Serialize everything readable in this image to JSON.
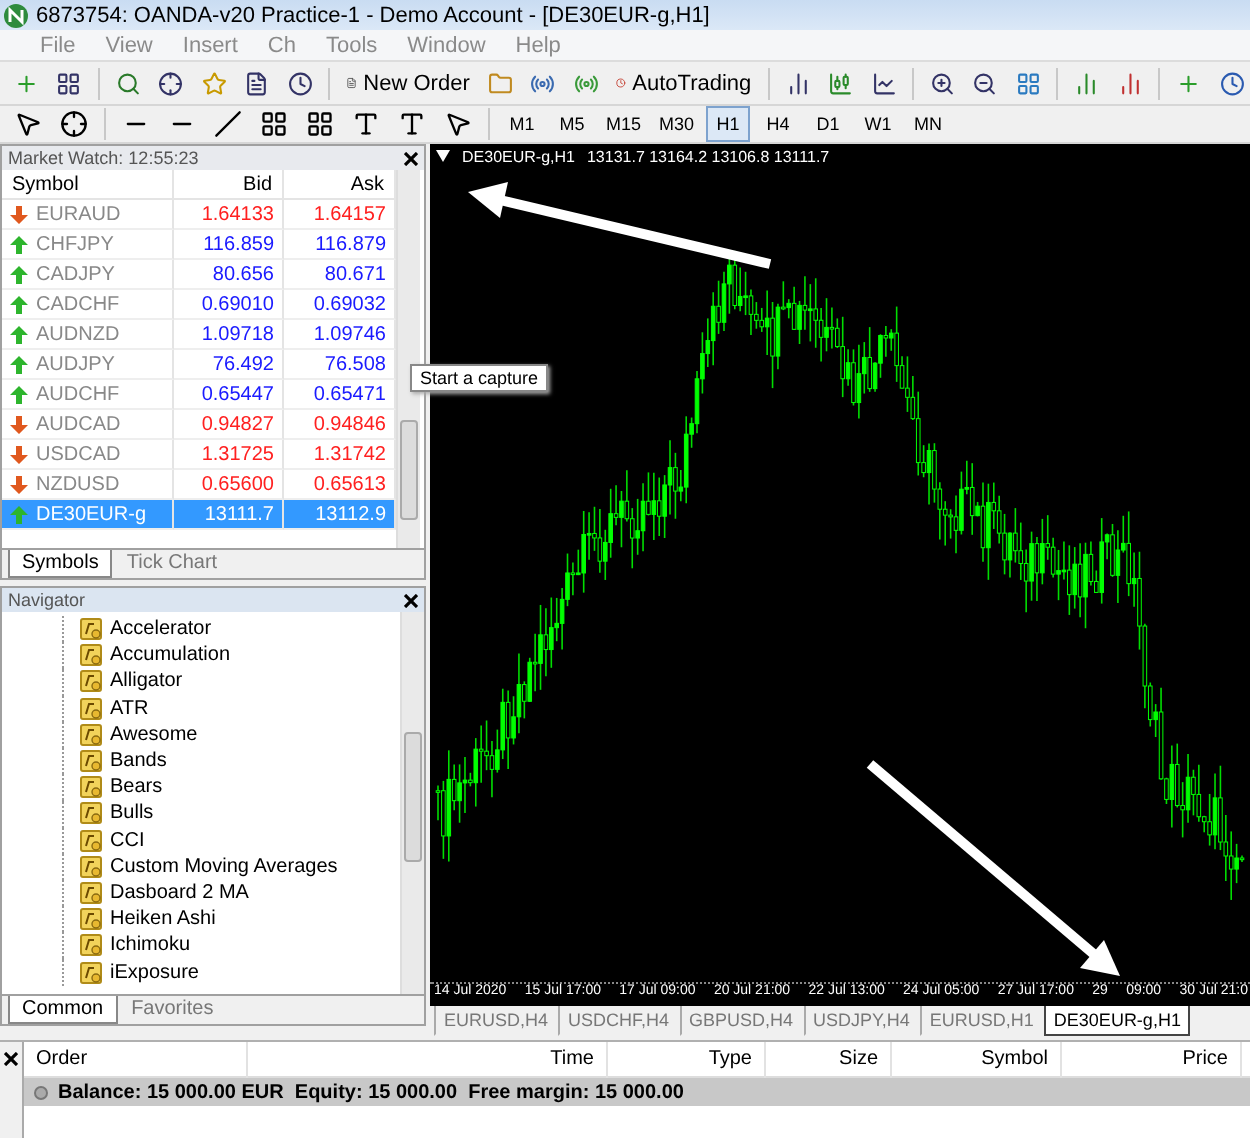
{
  "window": {
    "title": "6873754: OANDA-v20 Practice-1 - Demo Account - [DE30EUR-g,H1]"
  },
  "menu": [
    "File",
    "View",
    "Insert",
    "Ch",
    "Tools",
    "Window",
    "Help"
  ],
  "toolbar": {
    "new_order": "New Order",
    "autotrading": "AutoTrading"
  },
  "timeframes": [
    {
      "label": "M1",
      "selected": false
    },
    {
      "label": "M5",
      "selected": false
    },
    {
      "label": "M15",
      "selected": false
    },
    {
      "label": "M30",
      "selected": false
    },
    {
      "label": "H1",
      "selected": true
    },
    {
      "label": "H4",
      "selected": false
    },
    {
      "label": "D1",
      "selected": false
    },
    {
      "label": "W1",
      "selected": false
    },
    {
      "label": "MN",
      "selected": false
    }
  ],
  "market_watch": {
    "title": "Market Watch: 12:55:23",
    "columns": [
      "Symbol",
      "Bid",
      "Ask"
    ],
    "rows": [
      {
        "symbol": "EURAUD",
        "bid": "1.64133",
        "ask": "1.64157",
        "rising": false,
        "selected": false
      },
      {
        "symbol": "CHFJPY",
        "bid": "116.859",
        "ask": "116.879",
        "rising": true,
        "selected": false
      },
      {
        "symbol": "CADJPY",
        "bid": "80.656",
        "ask": "80.671",
        "rising": true,
        "selected": false
      },
      {
        "symbol": "CADCHF",
        "bid": "0.69010",
        "ask": "0.69032",
        "rising": true,
        "selected": false
      },
      {
        "symbol": "AUDNZD",
        "bid": "1.09718",
        "ask": "1.09746",
        "rising": true,
        "selected": false
      },
      {
        "symbol": "AUDJPY",
        "bid": "76.492",
        "ask": "76.508",
        "rising": true,
        "selected": false
      },
      {
        "symbol": "AUDCHF",
        "bid": "0.65447",
        "ask": "0.65471",
        "rising": true,
        "selected": false
      },
      {
        "symbol": "AUDCAD",
        "bid": "0.94827",
        "ask": "0.94846",
        "rising": false,
        "selected": false
      },
      {
        "symbol": "USDCAD",
        "bid": "1.31725",
        "ask": "1.31742",
        "rising": false,
        "selected": false
      },
      {
        "symbol": "NZDUSD",
        "bid": "0.65600",
        "ask": "0.65613",
        "rising": false,
        "selected": false
      },
      {
        "symbol": "DE30EUR-g",
        "bid": "13111.7",
        "ask": "13112.9",
        "rising": true,
        "selected": true
      }
    ],
    "tabs": [
      {
        "label": "Symbols",
        "selected": true
      },
      {
        "label": "Tick Chart",
        "selected": false
      }
    ]
  },
  "navigator": {
    "title": "Navigator",
    "items": [
      "Accelerator",
      "Accumulation",
      "Alligator",
      "ATR",
      "Awesome",
      "Bands",
      "Bears",
      "Bulls",
      "CCI",
      "Custom Moving Averages",
      "Dasboard 2 MA",
      "Heiken Ashi",
      "Ichimoku",
      "iExposure"
    ],
    "tabs": [
      {
        "label": "Common",
        "selected": true
      },
      {
        "label": "Favorites",
        "selected": false
      }
    ]
  },
  "chart": {
    "symbol": "DE30EUR-g,H1",
    "ohlc": "13131.7 13164.2 13106.8 13111.7",
    "time_labels": [
      "14 Jul 2020",
      "15 Jul 17:00",
      "17 Jul 09:00",
      "20 Jul 21:00",
      "22 Jul 13:00",
      "24 Jul 05:00",
      "27 Jul 17:00",
      "29",
      "09:00",
      "30 Jul 21:0"
    ],
    "tabs": [
      {
        "label": "EURUSD,H4",
        "selected": false
      },
      {
        "label": "USDCHF,H4",
        "selected": false
      },
      {
        "label": "GBPUSD,H4",
        "selected": false
      },
      {
        "label": "USDJPY,H4",
        "selected": false
      },
      {
        "label": "EURUSD,H1",
        "selected": false
      },
      {
        "label": "DE30EUR-g,H1",
        "selected": true
      }
    ]
  },
  "tooltip": "Start a capture",
  "terminal": {
    "columns": [
      "Order",
      "Time",
      "Type",
      "Size",
      "Symbol",
      "Price"
    ],
    "balance": "Balance: 15 000.00 EUR  Equity: 15 000.00  Free margin: 15 000.00"
  }
}
